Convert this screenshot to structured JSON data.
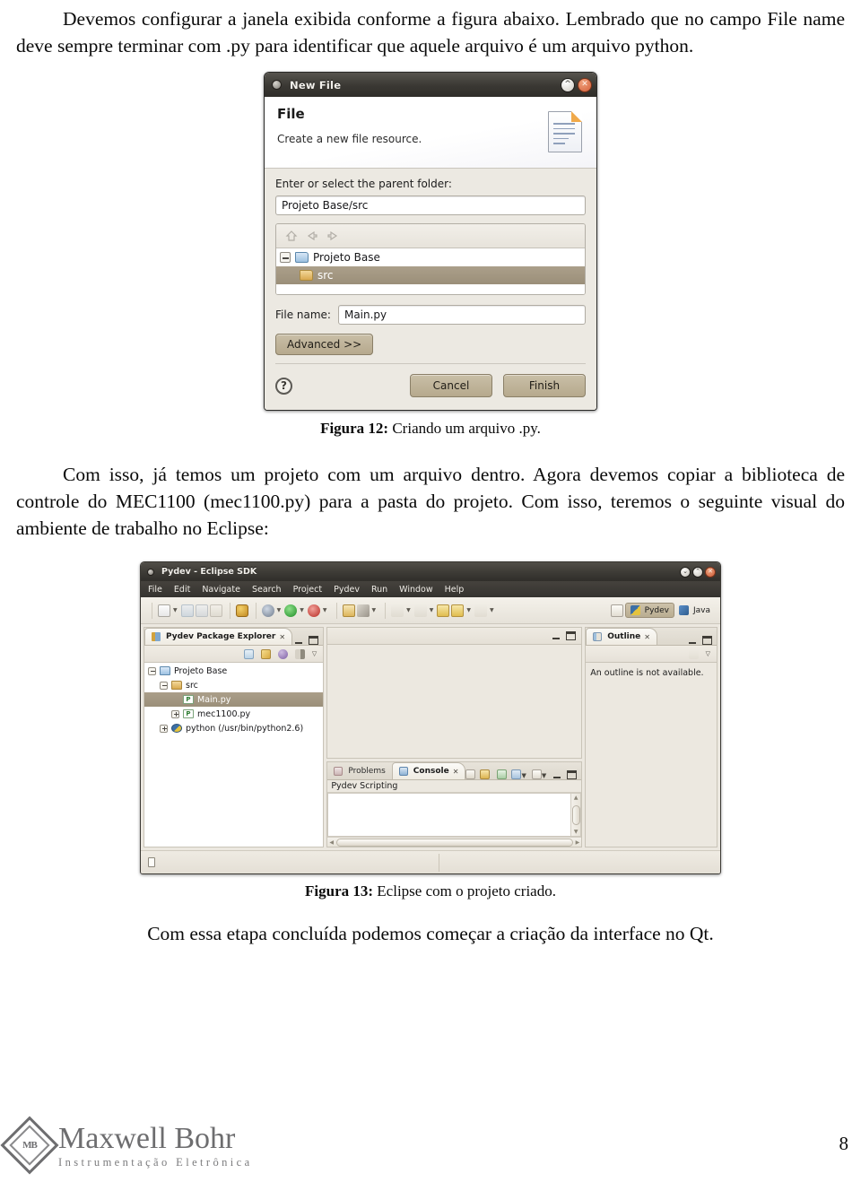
{
  "document": {
    "intro_paragraph": "Devemos configurar a janela exibida conforme a figura abaixo. Lembrado que no campo File name deve sempre terminar com .py para identificar que aquele arquivo é um arquivo python.",
    "figure12_caption_label": "Figura 12:",
    "figure12_caption_text": " Criando um arquivo .py.",
    "middle_paragraph": "Com isso, já temos um projeto com um arquivo dentro. Agora devemos copiar a biblioteca de controle do MEC1100 (mec1100.py) para a pasta do projeto. Com isso, teremos o seguinte visual do ambiente de trabalho no Eclipse:",
    "figure13_caption_label": "Figura 13:",
    "figure13_caption_text": " Eclipse com o projeto criado.",
    "closing_paragraph": "Com essa etapa concluída podemos começar a criação da interface no Qt.",
    "page_number": "8"
  },
  "footer_logo": {
    "emblem_text": "MB",
    "name": "Maxwell Bohr",
    "tagline": "Instrumentação Eletrônica"
  },
  "new_file_dialog": {
    "window_title": "New File",
    "window_buttons": {
      "maximize": "^",
      "close": "✕"
    },
    "heading": "File",
    "subheading": "Create a new file resource.",
    "parent_folder_label": "Enter or select the parent folder:",
    "parent_folder_value": "Projeto Base/src",
    "tree_toolbar_icons": [
      "home-icon",
      "back-arrow-icon",
      "forward-arrow-icon"
    ],
    "tree": [
      {
        "label": "Projeto Base",
        "icon": "project-folder-icon",
        "expander": "minus",
        "selected": false
      },
      {
        "label": "src",
        "icon": "folder-icon",
        "expander": "none",
        "selected": true
      }
    ],
    "file_name_label": "File name:",
    "file_name_value": "Main.py",
    "advanced_button": "Advanced >>",
    "help_button": "?",
    "cancel_button": "Cancel",
    "finish_button": "Finish"
  },
  "eclipse_window": {
    "window_title": "Pydev - Eclipse SDK",
    "window_buttons": {
      "minimize": "⌄",
      "maximize": "⌃",
      "close": "✕"
    },
    "menu_items": [
      "File",
      "Edit",
      "Navigate",
      "Search",
      "Project",
      "Pydev",
      "Run",
      "Window",
      "Help"
    ],
    "perspectives": [
      {
        "label": "Pydev",
        "active": true
      },
      {
        "label": "Java",
        "active": false
      }
    ],
    "package_explorer": {
      "tab_label": "Pydev Package Explorer",
      "tree": [
        {
          "label": "Projeto Base",
          "icon": "project-folder-icon",
          "expander": "minus",
          "indent": 0,
          "selected": false
        },
        {
          "label": "src",
          "icon": "source-folder-icon",
          "expander": "minus",
          "indent": 1,
          "selected": false
        },
        {
          "label": "Main.py",
          "icon": "python-file-icon",
          "expander": "none",
          "indent": 2,
          "selected": true
        },
        {
          "label": "mec1100.py",
          "icon": "python-file-icon",
          "expander": "plus",
          "indent": 2,
          "selected": false
        },
        {
          "label": "python  (/usr/bin/python2.6)",
          "icon": "python-interpreter-icon",
          "expander": "plus",
          "indent": 1,
          "selected": false
        }
      ]
    },
    "outline": {
      "tab_label": "Outline",
      "message": "An outline is not available."
    },
    "bottom_panel": {
      "tabs": [
        {
          "label": "Problems",
          "active": false
        },
        {
          "label": "Console",
          "active": true
        }
      ],
      "console_title": "Pydev Scripting",
      "console_content": ""
    }
  }
}
